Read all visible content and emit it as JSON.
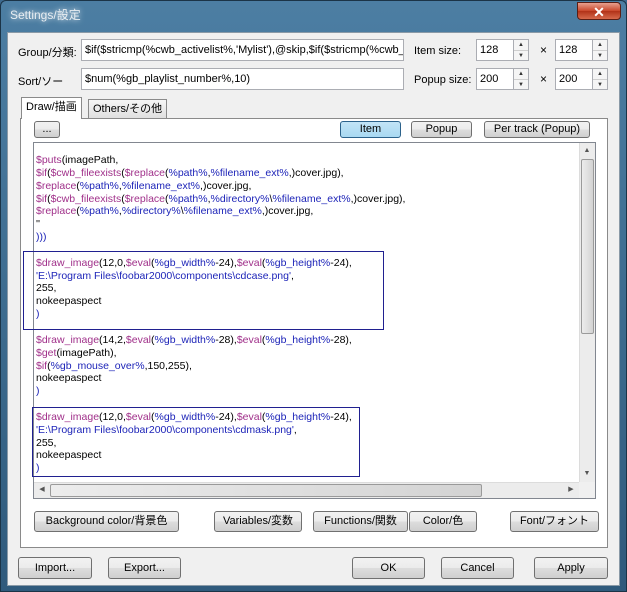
{
  "window": {
    "title": "Settings/設定",
    "close_glyph": "✕"
  },
  "group": {
    "label": "Group/分類:",
    "value": "$if($stricmp(%cwb_activelist%,'Mylist'),@skip,$if($stricmp(%cwb_"
  },
  "sort": {
    "label": "Sort/ソー",
    "value": "$num(%gb_playlist_number%,10)"
  },
  "item_size": {
    "label": "Item size:",
    "width": "128",
    "times": "×",
    "height": "128"
  },
  "popup_size": {
    "label": "Popup size:",
    "width": "200",
    "times": "×",
    "height": "200"
  },
  "tabs": [
    {
      "label": "Draw/描画"
    },
    {
      "label": "Others/その他"
    }
  ],
  "editor_toolbar": {
    "more": "...",
    "item": "Item",
    "popup": "Popup",
    "per_track": "Per track (Popup)"
  },
  "code_lines": [
    [
      [
        "fn",
        "$puts"
      ],
      [
        "t",
        "(imagePath,"
      ]
    ],
    [
      [
        "fn",
        "$if"
      ],
      [
        "t",
        "("
      ],
      [
        "fn",
        "$cwb_fileexists"
      ],
      [
        "t",
        "("
      ],
      [
        "fn",
        "$replace"
      ],
      [
        "t",
        "("
      ],
      [
        "var",
        "%path%"
      ],
      [
        "t",
        ","
      ],
      [
        "var",
        "%filename_ext%"
      ],
      [
        "t",
        ",)cover.jpg),"
      ]
    ],
    [
      [
        "fn",
        "$replace"
      ],
      [
        "t",
        "("
      ],
      [
        "var",
        "%path%"
      ],
      [
        "t",
        ","
      ],
      [
        "var",
        "%filename_ext%"
      ],
      [
        "t",
        ",)cover.jpg,"
      ]
    ],
    [
      [
        "fn",
        "$if"
      ],
      [
        "t",
        "("
      ],
      [
        "fn",
        "$cwb_fileexists"
      ],
      [
        "t",
        "("
      ],
      [
        "fn",
        "$replace"
      ],
      [
        "t",
        "("
      ],
      [
        "var",
        "%path%"
      ],
      [
        "t",
        ","
      ],
      [
        "var",
        "%directory%"
      ],
      [
        "t",
        "\\"
      ],
      [
        "var",
        "%filename_ext%"
      ],
      [
        "t",
        ",)cover.jpg),"
      ]
    ],
    [
      [
        "fn",
        "$replace"
      ],
      [
        "t",
        "("
      ],
      [
        "var",
        "%path%"
      ],
      [
        "t",
        ","
      ],
      [
        "var",
        "%directory%"
      ],
      [
        "t",
        "\\"
      ],
      [
        "var",
        "%filename_ext%"
      ],
      [
        "t",
        ",)cover.jpg,"
      ]
    ],
    [
      [
        "t",
        "''"
      ]
    ],
    [
      [
        "var",
        ")))"
      ]
    ],
    [],
    [
      [
        "fn",
        "$draw_image"
      ],
      [
        "t",
        "(12,0,"
      ],
      [
        "fn",
        "$eval"
      ],
      [
        "t",
        "("
      ],
      [
        "var",
        "%gb_width%"
      ],
      [
        "t",
        "-24),"
      ],
      [
        "fn",
        "$eval"
      ],
      [
        "t",
        "("
      ],
      [
        "var",
        "%gb_height%"
      ],
      [
        "t",
        "-24),"
      ]
    ],
    [
      [
        "str",
        "'E:\\Program Files\\foobar2000\\components\\cdcase.png'"
      ],
      [
        "t",
        ","
      ]
    ],
    [
      [
        "t",
        "255,"
      ]
    ],
    [
      [
        "t",
        "nokeepaspect"
      ]
    ],
    [
      [
        "var",
        ")"
      ]
    ],
    [],
    [
      [
        "fn",
        "$draw_image"
      ],
      [
        "t",
        "(14,2,"
      ],
      [
        "fn",
        "$eval"
      ],
      [
        "t",
        "("
      ],
      [
        "var",
        "%gb_width%"
      ],
      [
        "t",
        "-28),"
      ],
      [
        "fn",
        "$eval"
      ],
      [
        "t",
        "("
      ],
      [
        "var",
        "%gb_height%"
      ],
      [
        "t",
        "-28),"
      ]
    ],
    [
      [
        "fn",
        "$get"
      ],
      [
        "t",
        "(imagePath),"
      ]
    ],
    [
      [
        "fn",
        "$if"
      ],
      [
        "t",
        "("
      ],
      [
        "var",
        "%gb_mouse_over%"
      ],
      [
        "t",
        ",150,255),"
      ]
    ],
    [
      [
        "t",
        "nokeepaspect"
      ]
    ],
    [
      [
        "var",
        ")"
      ]
    ],
    [],
    [
      [
        "fn",
        "$draw_image"
      ],
      [
        "t",
        "(12,0,"
      ],
      [
        "fn",
        "$eval"
      ],
      [
        "t",
        "("
      ],
      [
        "var",
        "%gb_width%"
      ],
      [
        "t",
        "-24),"
      ],
      [
        "fn",
        "$eval"
      ],
      [
        "t",
        "("
      ],
      [
        "var",
        "%gb_height%"
      ],
      [
        "t",
        "-24),"
      ]
    ],
    [
      [
        "str",
        "'E:\\Program Files\\foobar2000\\components\\cdmask.png'"
      ],
      [
        "t",
        ","
      ]
    ],
    [
      [
        "t",
        "255,"
      ]
    ],
    [
      [
        "t",
        "nokeepaspect"
      ]
    ],
    [
      [
        "var",
        ")"
      ]
    ]
  ],
  "panel_buttons": {
    "background": "Background color/背景色",
    "variables": "Variables/変数",
    "functions": "Functions/関数",
    "color": "Color/色",
    "font": "Font/フォント"
  },
  "footer": {
    "import": "Import...",
    "export": "Export...",
    "ok": "OK",
    "cancel": "Cancel",
    "apply": "Apply"
  },
  "colors": {
    "function": "#a0308a",
    "variable": "#1d24b8",
    "highlight_box": "#202090"
  }
}
